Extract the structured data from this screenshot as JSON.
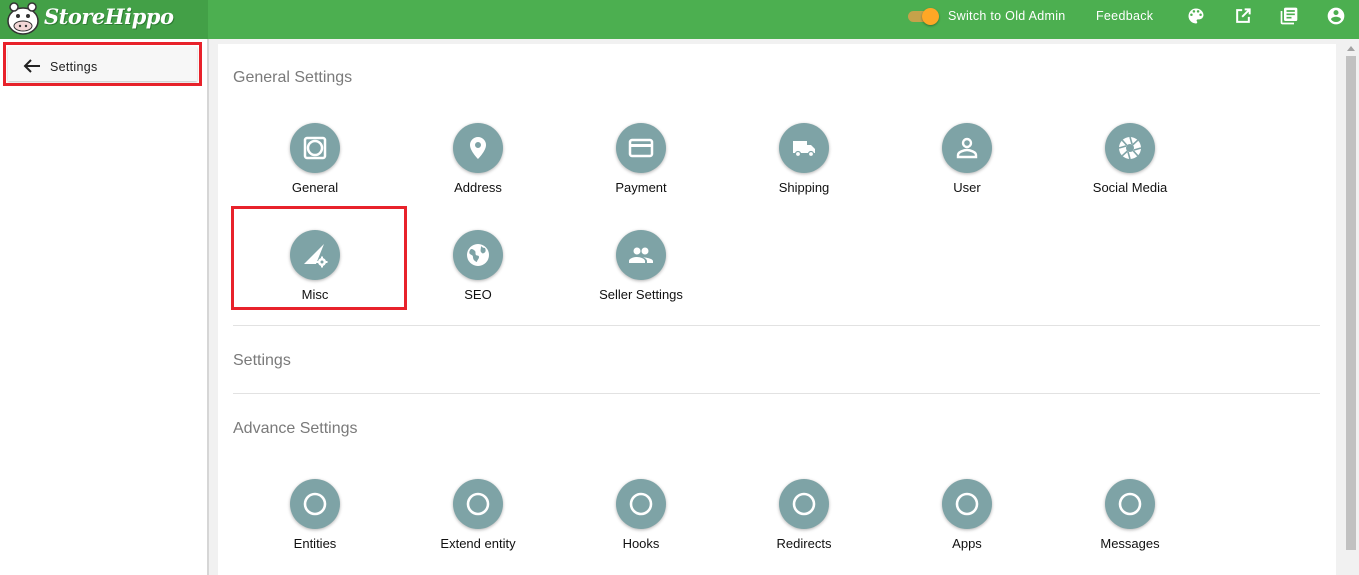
{
  "header": {
    "brand": "StoreHippo",
    "switch_label": "Switch to Old Admin",
    "feedback_label": "Feedback"
  },
  "sidebar": {
    "back_label": "Settings"
  },
  "main": {
    "general_title": "General Settings",
    "general_items": [
      {
        "label": "General",
        "icon": "frame-icon"
      },
      {
        "label": "Address",
        "icon": "map-pin-icon"
      },
      {
        "label": "Payment",
        "icon": "credit-card-icon"
      },
      {
        "label": "Shipping",
        "icon": "truck-icon"
      },
      {
        "label": "User",
        "icon": "person-icon"
      },
      {
        "label": "Social Media",
        "icon": "aperture-icon"
      },
      {
        "label": "Misc",
        "icon": "signal-settings-icon"
      },
      {
        "label": "SEO",
        "icon": "globe-icon"
      },
      {
        "label": "Seller Settings",
        "icon": "people-icon"
      }
    ],
    "settings_title": "Settings",
    "advance_title": "Advance Settings",
    "advance_items": [
      {
        "label": "Entities",
        "icon": "ring-icon"
      },
      {
        "label": "Extend entity",
        "icon": "ring-icon"
      },
      {
        "label": "Hooks",
        "icon": "ring-icon"
      },
      {
        "label": "Redirects",
        "icon": "ring-icon"
      },
      {
        "label": "Apps",
        "icon": "ring-icon"
      },
      {
        "label": "Messages",
        "icon": "ring-icon"
      }
    ]
  },
  "colors": {
    "header_green": "#4caf50",
    "icon_circle": "#7ea3a6",
    "highlight_red": "#e8222b",
    "toggle_knob": "#ffa726"
  }
}
